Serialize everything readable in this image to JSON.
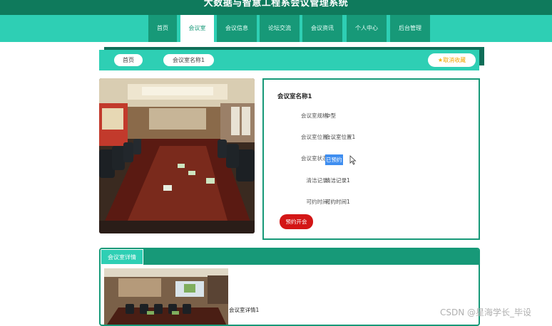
{
  "header": {
    "title": "大数据与智慧工程系会议管理系统"
  },
  "nav": {
    "items": [
      {
        "label": "首页"
      },
      {
        "label": "会议室"
      },
      {
        "label": "会议信息"
      },
      {
        "label": "论坛交流"
      },
      {
        "label": "会议资讯"
      },
      {
        "label": "个人中心"
      },
      {
        "label": "后台管理"
      }
    ],
    "active_index": 1
  },
  "breadcrumb": {
    "home": "首页",
    "current": "会议室名称1"
  },
  "favorite_button": {
    "label": "取消收藏"
  },
  "room": {
    "name": "会议室名称1",
    "fields": [
      {
        "label": "会议室规格:",
        "value": "中型"
      },
      {
        "label": "会议室位置:",
        "value": "会议室位置1"
      },
      {
        "label": "会议室状态:",
        "value": "已预约"
      },
      {
        "label": "清洁记录:",
        "value": "清洁记录1"
      },
      {
        "label": "可约时间:",
        "value": "可约时间1"
      }
    ],
    "book_button": "预约开会"
  },
  "detail": {
    "tab_label": "会议室详情",
    "text": "会议室详情1"
  },
  "watermark": "CSDN @星海学长_毕设",
  "colors": {
    "dark_green": "#0f7a5c",
    "teal": "#2ecfb4",
    "tab_green": "#179978",
    "red": "#d31616",
    "highlight_blue": "#3f8ef0"
  }
}
